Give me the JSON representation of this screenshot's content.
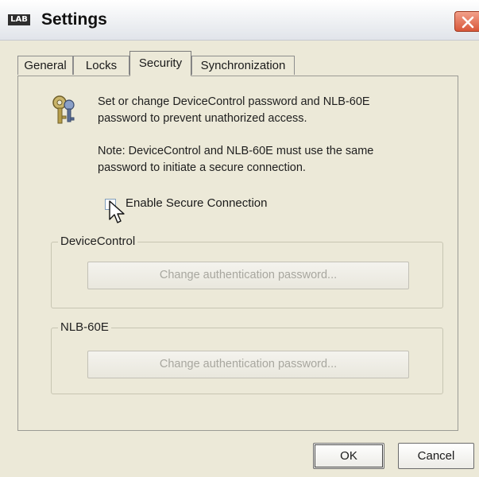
{
  "window": {
    "logo_text": "LAB",
    "title": "Settings"
  },
  "tabs": [
    {
      "label": "General",
      "active": false
    },
    {
      "label": "Locks",
      "active": false
    },
    {
      "label": "Security",
      "active": true
    },
    {
      "label": "Synchronization",
      "active": false
    }
  ],
  "security": {
    "icon": "keys-icon",
    "description": "Set or change DeviceControl password and NLB-60E\npassword to prevent unathorized access.",
    "note": "Note: DeviceControl and NLB-60E must use the same\npassword to initiate a secure connection.",
    "enable_label": "Enable Secure Connection",
    "enable_checked": false
  },
  "groups": {
    "device_control": {
      "label": "DeviceControl",
      "button": "Change authentication password..."
    },
    "nlb": {
      "label": "NLB-60E",
      "button": "Change authentication password..."
    }
  },
  "footer": {
    "ok": "OK",
    "cancel": "Cancel"
  },
  "colors": {
    "dialog_face": "#ece9d8",
    "close_button": "#d8573a",
    "disabled_text": "#a8a79f"
  }
}
